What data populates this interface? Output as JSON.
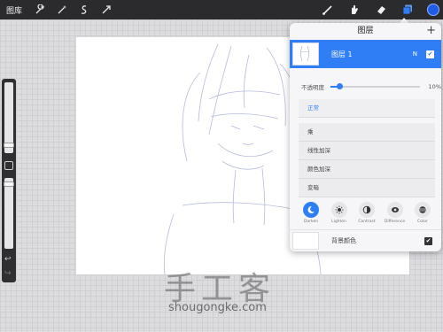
{
  "toolbar": {
    "gallery_label": "图库",
    "left_icons": [
      "wrench-icon",
      "magic-wand-icon",
      "selection-icon",
      "transform-icon"
    ],
    "right_icons": [
      "brush-icon",
      "smudge-icon",
      "eraser-icon",
      "layers-icon"
    ],
    "active_color": "#1e5be6"
  },
  "layers_panel": {
    "title": "图层",
    "add_label": "+",
    "layer": {
      "name": "图层 1",
      "blend_letter": "N",
      "visible_mark": "✔"
    },
    "opacity": {
      "label": "不透明度",
      "value_text": "10%",
      "value": 0.1
    },
    "blend_modes": {
      "selected": "正常",
      "options": [
        "乘",
        "线性加深",
        "颜色加深",
        "变暗"
      ]
    },
    "mode_buttons": [
      {
        "label": "Darken",
        "active": true
      },
      {
        "label": "Lighten",
        "active": false
      },
      {
        "label": "Contrast",
        "active": false
      },
      {
        "label": "Difference",
        "active": false
      },
      {
        "label": "Color",
        "active": false
      }
    ],
    "background": {
      "label": "背景颜色",
      "visible_mark": "✔"
    }
  },
  "side_controls": {
    "undo": "↩",
    "redo": "↪"
  },
  "watermark": {
    "title": "手工客",
    "url": "shougongke.com"
  },
  "colors": {
    "accent": "#2f7ef5",
    "toolbar": "#2b2b2d"
  }
}
